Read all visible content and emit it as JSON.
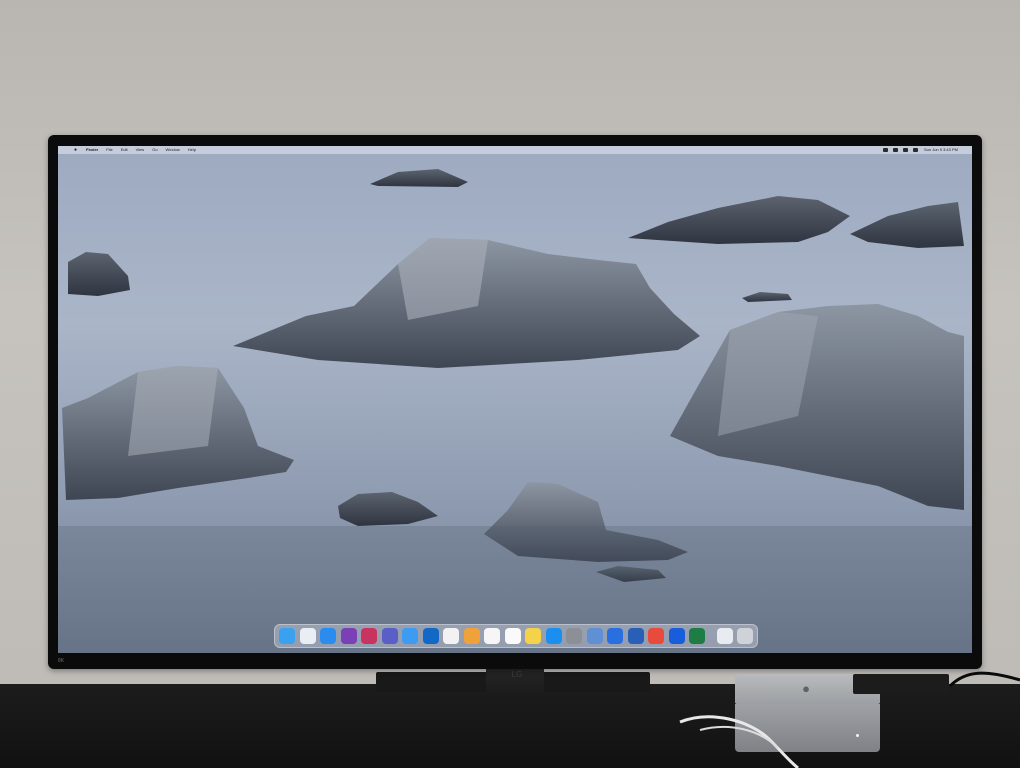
{
  "menubar": {
    "items": [
      "Finder",
      "File",
      "Edit",
      "View",
      "Go",
      "Window",
      "Help"
    ],
    "clock": "Sun Jun 9 3:43 PM"
  },
  "dock": {
    "apps": [
      {
        "icon": "finder-icon",
        "color": "#3aa0f0"
      },
      {
        "icon": "launchpad-icon",
        "color": "#e9eef5"
      },
      {
        "icon": "safari-icon",
        "color": "#2b8cf0"
      },
      {
        "icon": "onenote-icon",
        "color": "#7b3fb6"
      },
      {
        "icon": "slack-icon",
        "color": "#c9335f"
      },
      {
        "icon": "teams-icon",
        "color": "#5a5fc7"
      },
      {
        "icon": "mail-icon",
        "color": "#3d9bf2"
      },
      {
        "icon": "outlook-icon",
        "color": "#1168c5"
      },
      {
        "icon": "news-icon",
        "color": "#f2f2f2"
      },
      {
        "icon": "photos-icon",
        "color": "#f0a23a"
      },
      {
        "icon": "calendar-icon",
        "color": "#f6f6f6"
      },
      {
        "icon": "reminders-icon",
        "color": "#fafafa"
      },
      {
        "icon": "notes-icon",
        "color": "#f4d34a"
      },
      {
        "icon": "app-store-icon",
        "color": "#1b8ff0"
      },
      {
        "icon": "system-settings-icon",
        "color": "#8c8f95"
      },
      {
        "icon": "preview-icon",
        "color": "#5f8fd4"
      },
      {
        "icon": "1password-icon",
        "color": "#2a6fe0"
      },
      {
        "icon": "word-icon",
        "color": "#2a5fb8"
      },
      {
        "icon": "chrome-icon",
        "color": "#e84a3c"
      },
      {
        "icon": "bitwarden-icon",
        "color": "#175ddc"
      },
      {
        "icon": "excel-icon",
        "color": "#1e7c45"
      }
    ],
    "right": [
      {
        "icon": "document-icon",
        "color": "#e8ebef"
      },
      {
        "icon": "trash-icon",
        "color": "#cfd3d8"
      }
    ]
  },
  "hardware": {
    "monitor_logo": "LG",
    "monitor_badge": "8K"
  }
}
